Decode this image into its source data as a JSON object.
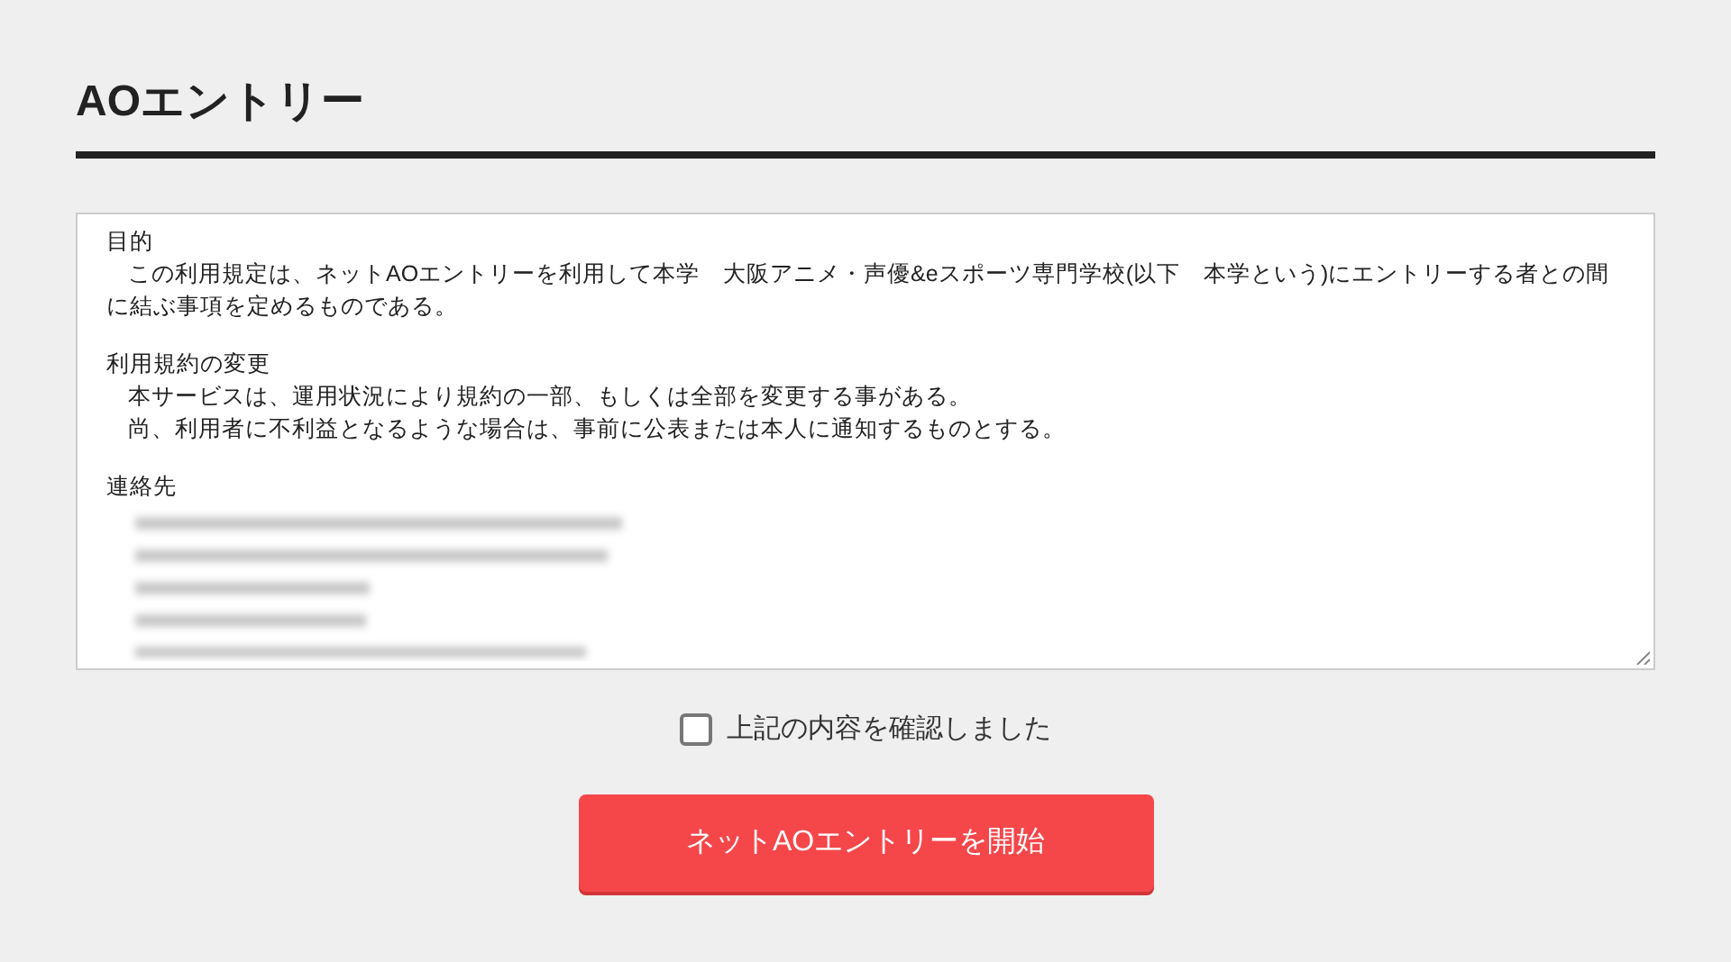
{
  "title": "AOエントリー",
  "terms": [
    {
      "heading": "目的",
      "lines": [
        "この利用規定は、ネットAOエントリーを利用して本学　大阪アニメ・声優&eスポーツ専門学校(以下　本学という)にエントリーする者との間に結ぶ事項を定めるものである。"
      ]
    },
    {
      "heading": "利用規約の変更",
      "lines": [
        "本サービスは、運用状況により規約の一部、もしくは全部を変更する事がある。",
        "尚、利用者に不利益となるような場合は、事前に公表または本人に通知するものとする。"
      ]
    },
    {
      "heading": "連絡先"
    }
  ],
  "agree": {
    "label": "上記の内容を確認しました",
    "checked": false
  },
  "start_button": "ネットAOエントリーを開始"
}
